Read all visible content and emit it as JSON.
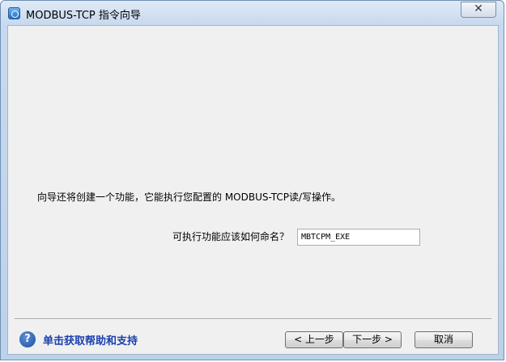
{
  "window": {
    "title": "MODBUS-TCP 指令向导",
    "close_label": "✕"
  },
  "content": {
    "intro": "向导还将创建一个功能，它能执行您配置的 MODBUS-TCP读/写操作。",
    "name_label": "可执行功能应该如何命名？",
    "name_value": "MBTCPM_EXE"
  },
  "footer": {
    "help_icon": "question-icon",
    "help_text": "单击获取帮助和支持",
    "back_label": "< 上一步",
    "next_label": "下一步 >",
    "cancel_label": "取消"
  },
  "colors": {
    "help_link": "#1a3fae",
    "client_bg": "#f0f0f0"
  }
}
